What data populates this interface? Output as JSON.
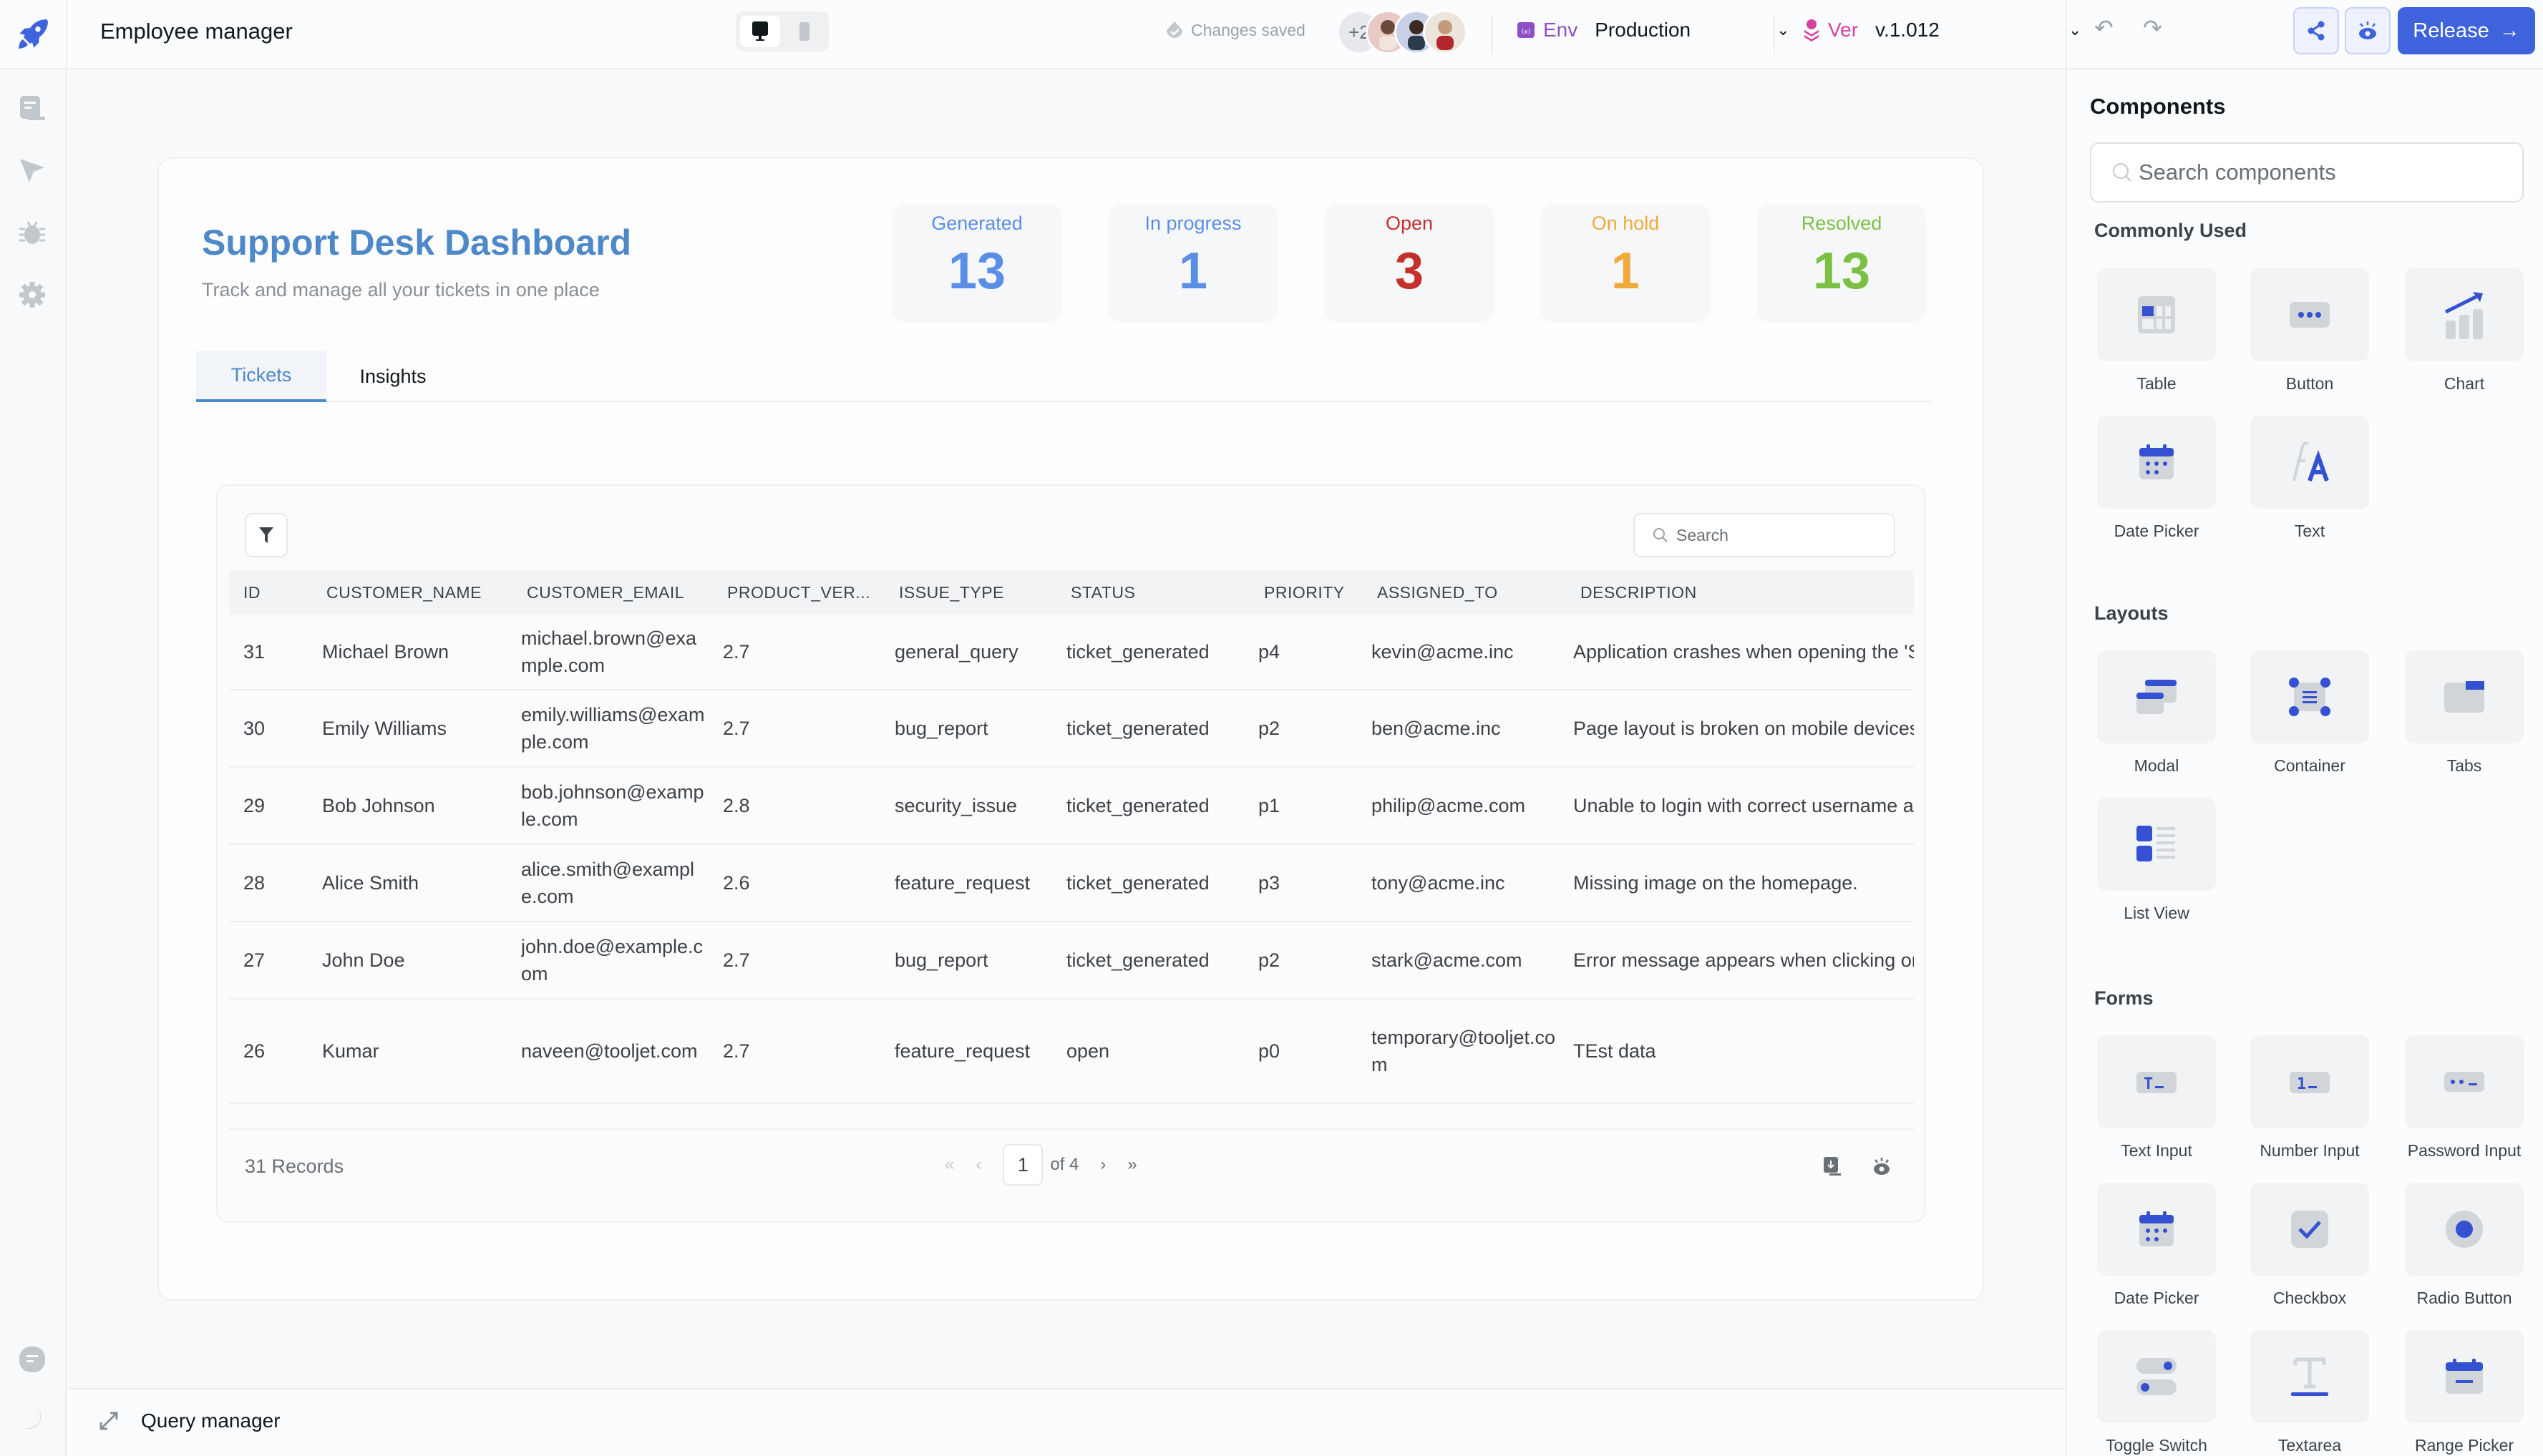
{
  "topbar": {
    "app_title": "Employee manager",
    "save_status": "Changes saved",
    "collaborators_extra": "+2",
    "env_label": "Env",
    "env_value": "Production",
    "version_label": "Ver",
    "version_value": "v.1.012",
    "release_label": "Release"
  },
  "header": {
    "title": "Support Desk Dashboard",
    "subtitle": "Track and manage all your tickets in one place"
  },
  "stats": [
    {
      "label": "Generated",
      "value": "13",
      "color": "#5b8ee6"
    },
    {
      "label": "In progress",
      "value": "1",
      "color": "#5b8ee6"
    },
    {
      "label": "Open",
      "value": "3",
      "color": "#c4302b"
    },
    {
      "label": "On hold",
      "value": "1",
      "color": "#f0a93b"
    },
    {
      "label": "Resolved",
      "value": "13",
      "color": "#7bc043"
    }
  ],
  "tabs": [
    {
      "label": "Tickets",
      "active": true
    },
    {
      "label": "Insights",
      "active": false
    }
  ],
  "table": {
    "search_placeholder": "Search",
    "columns": [
      "ID",
      "CUSTOMER_NAME",
      "CUSTOMER_EMAIL",
      "PRODUCT_VER...",
      "ISSUE_TYPE",
      "STATUS",
      "PRIORITY",
      "ASSIGNED_TO",
      "DESCRIPTION"
    ],
    "rows": [
      {
        "id": "31",
        "name": "Michael Brown",
        "email": "michael.brown@example.com",
        "ver": "2.7",
        "issue": "general_query",
        "status": "ticket_generated",
        "priority": "p4",
        "assigned": "kevin@acme.inc",
        "desc": "Application crashes when opening the 'S"
      },
      {
        "id": "30",
        "name": "Emily Williams",
        "email": "emily.williams@example.com",
        "ver": "2.7",
        "issue": "bug_report",
        "status": "ticket_generated",
        "priority": "p2",
        "assigned": "ben@acme.inc",
        "desc": "Page layout is broken on mobile devices"
      },
      {
        "id": "29",
        "name": "Bob Johnson",
        "email": "bob.johnson@example.com",
        "ver": "2.8",
        "issue": "security_issue",
        "status": "ticket_generated",
        "priority": "p1",
        "assigned": "philip@acme.com",
        "desc": "Unable to login with correct username a"
      },
      {
        "id": "28",
        "name": "Alice Smith",
        "email": "alice.smith@example.com",
        "ver": "2.6",
        "issue": "feature_request",
        "status": "ticket_generated",
        "priority": "p3",
        "assigned": "tony@acme.inc",
        "desc": "Missing image on the homepage."
      },
      {
        "id": "27",
        "name": "John Doe",
        "email": "john.doe@example.com",
        "ver": "2.7",
        "issue": "bug_report",
        "status": "ticket_generated",
        "priority": "p2",
        "assigned": "stark@acme.com",
        "desc": "Error message appears when clicking or"
      },
      {
        "id": "26",
        "name": "Kumar",
        "email": "naveen@tooljet.com",
        "ver": "2.7",
        "issue": "feature_request",
        "status": "open",
        "priority": "p0",
        "assigned": "temporary@tooljet.com",
        "desc": "TEst data"
      }
    ],
    "records_label": "31 Records",
    "current_page": "1",
    "page_of": "of 4"
  },
  "bottombar": {
    "query_manager_label": "Query manager"
  },
  "components_panel": {
    "title": "Components",
    "search_placeholder": "Search components",
    "sections": [
      {
        "title": "Commonly Used",
        "items": [
          "Table",
          "Button",
          "Chart",
          "Date Picker",
          "Text"
        ]
      },
      {
        "title": "Layouts",
        "items": [
          "Modal",
          "Container",
          "Tabs",
          "List View"
        ]
      },
      {
        "title": "Forms",
        "items": [
          "Text Input",
          "Number Input",
          "Password Input",
          "Date Picker",
          "Checkbox",
          "Radio Button",
          "Toggle Switch",
          "Textarea",
          "Range Picker"
        ]
      }
    ]
  },
  "colors": {
    "accent": "#3e63dd",
    "title_blue": "#4d88c9"
  }
}
